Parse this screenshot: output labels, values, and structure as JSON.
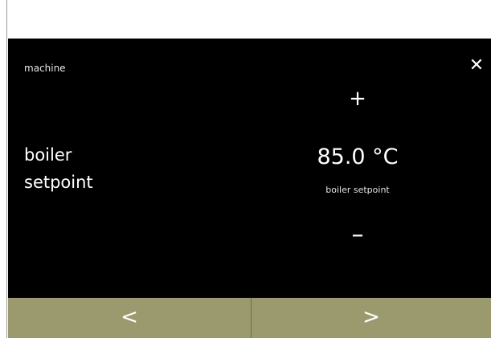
{
  "header": {
    "breadcrumb": "machine",
    "close_icon": "close-icon",
    "close_glyph": "✕"
  },
  "setting": {
    "title": "boiler\nsetpoint",
    "value": "85.0 °C",
    "caption": "boiler setpoint",
    "increase_label": "+",
    "decrease_label": "–"
  },
  "nav": {
    "prev_label": "<",
    "next_label": ">"
  },
  "colors": {
    "screen_background": "#000000",
    "nav_bar": "#9a9a6e",
    "text": "#ffffff"
  }
}
